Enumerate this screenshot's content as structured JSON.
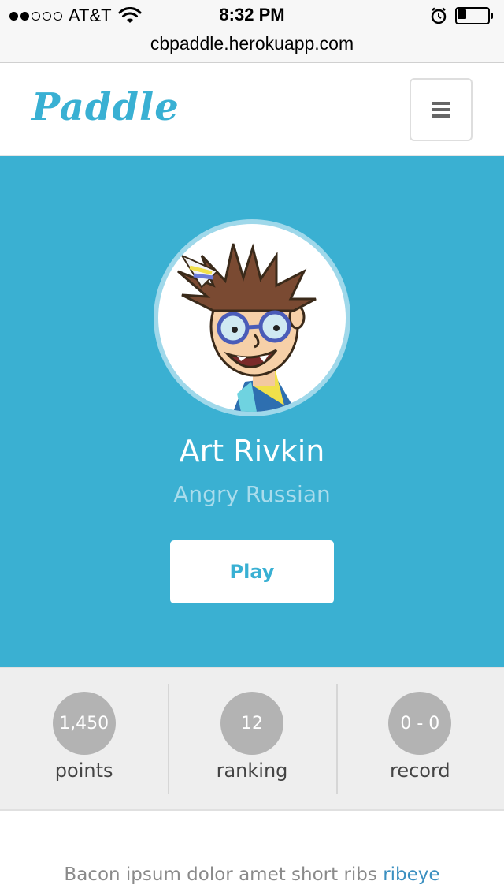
{
  "status_bar": {
    "signal": [
      true,
      true,
      false,
      false,
      false
    ],
    "carrier": "AT&T",
    "time": "8:32 PM",
    "battery_level": 0.3
  },
  "browser": {
    "url": "cbpaddle.herokuapp.com"
  },
  "navbar": {
    "logo": "Paddle",
    "menu_icon": "hamburger-icon"
  },
  "profile": {
    "name": "Art Rivkin",
    "title": "Angry Russian",
    "play_label": "Play"
  },
  "stats": [
    {
      "value": "1,450",
      "label": "points"
    },
    {
      "value": "12",
      "label": "ranking"
    },
    {
      "value": "0 - 0",
      "label": "record"
    }
  ],
  "content": {
    "text": "Bacon ipsum dolor amet short ribs ",
    "link": "ribeye"
  },
  "colors": {
    "brand": "#3ab0d2",
    "stat_circle": "#b3b3b3",
    "link": "#3a8fc0"
  }
}
